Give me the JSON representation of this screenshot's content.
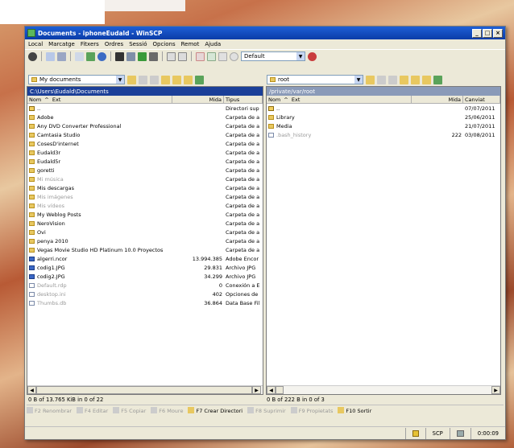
{
  "window": {
    "title": "Documents - iphoneEudald - WinSCP"
  },
  "menu": [
    "Local",
    "Marcatge",
    "Fitxers",
    "Ordres",
    "Sessió",
    "Opcions",
    "Remot",
    "Ajuda"
  ],
  "toolbar": {
    "transfer_setting": "Default"
  },
  "left_location": "My documents",
  "right_location": "root",
  "left_pane": {
    "path": "C:\\Users\\Eudald\\Documents",
    "columns": [
      "Nom",
      "Ext",
      "Mida",
      "Tipus"
    ],
    "rows": [
      {
        "name": "..",
        "size": "",
        "type": "Directori sup",
        "icon": "updir",
        "hidden": false
      },
      {
        "name": "Adobe",
        "size": "",
        "type": "Carpeta de a",
        "icon": "folder",
        "hidden": false
      },
      {
        "name": "Any DVD Converter Professional",
        "size": "",
        "type": "Carpeta de a",
        "icon": "folder",
        "hidden": false
      },
      {
        "name": "Camtasia Studio",
        "size": "",
        "type": "Carpeta de a",
        "icon": "folder",
        "hidden": false
      },
      {
        "name": "CosesD'internet",
        "size": "",
        "type": "Carpeta de a",
        "icon": "folder",
        "hidden": false
      },
      {
        "name": "Eudald3r",
        "size": "",
        "type": "Carpeta de a",
        "icon": "folder",
        "hidden": false
      },
      {
        "name": "Eudald5r",
        "size": "",
        "type": "Carpeta de a",
        "icon": "folder",
        "hidden": false
      },
      {
        "name": "goretti",
        "size": "",
        "type": "Carpeta de a",
        "icon": "folder",
        "hidden": false
      },
      {
        "name": "Mi música",
        "size": "",
        "type": "Carpeta de a",
        "icon": "folder",
        "hidden": true
      },
      {
        "name": "Mis descargas",
        "size": "",
        "type": "Carpeta de a",
        "icon": "folder",
        "hidden": false
      },
      {
        "name": "Mis imágenes",
        "size": "",
        "type": "Carpeta de a",
        "icon": "folder",
        "hidden": true
      },
      {
        "name": "Mis vídeos",
        "size": "",
        "type": "Carpeta de a",
        "icon": "folder",
        "hidden": true
      },
      {
        "name": "My Weblog Posts",
        "size": "",
        "type": "Carpeta de a",
        "icon": "folder",
        "hidden": false
      },
      {
        "name": "NeroVision",
        "size": "",
        "type": "Carpeta de a",
        "icon": "folder",
        "hidden": false
      },
      {
        "name": "Ovi",
        "size": "",
        "type": "Carpeta de a",
        "icon": "folder",
        "hidden": false
      },
      {
        "name": "penya 2010",
        "size": "",
        "type": "Carpeta de a",
        "icon": "folder",
        "hidden": false
      },
      {
        "name": "Vegas Movie Studio HD Platinum 10.0 Proyectos",
        "size": "",
        "type": "Carpeta de a",
        "icon": "folder",
        "hidden": false
      },
      {
        "name": "algerri.ncor",
        "size": "13.994.385",
        "type": "Adobe Encor",
        "icon": "file-blue",
        "hidden": false
      },
      {
        "name": "codig1.JPG",
        "size": "29.831",
        "type": "Archivo JPG",
        "icon": "file-blue",
        "hidden": false
      },
      {
        "name": "codig2.JPG",
        "size": "34.299",
        "type": "Archivo JPG",
        "icon": "file-blue",
        "hidden": false
      },
      {
        "name": "Default.rdp",
        "size": "0",
        "type": "Conexión a E",
        "icon": "file-generic",
        "hidden": true
      },
      {
        "name": "desktop.ini",
        "size": "402",
        "type": "Opciones de",
        "icon": "file-generic",
        "hidden": true
      },
      {
        "name": "Thumbs.db",
        "size": "36.864",
        "type": "Data Base Fil",
        "icon": "file-generic",
        "hidden": true
      }
    ],
    "status": "0 B of 13.765 KiB in 0 of 22"
  },
  "right_pane": {
    "path": "/private/var/root",
    "columns": [
      "Nom",
      "Ext",
      "Mida",
      "Canviat"
    ],
    "rows": [
      {
        "name": "..",
        "size": "",
        "changed": "07/07/2011",
        "icon": "updir",
        "hidden": false
      },
      {
        "name": "Library",
        "size": "",
        "changed": "25/06/2011",
        "icon": "folder",
        "hidden": false
      },
      {
        "name": "Media",
        "size": "",
        "changed": "21/07/2011",
        "icon": "folder",
        "hidden": false
      },
      {
        "name": ".bash_history",
        "size": "222",
        "changed": "03/08/2011",
        "icon": "file-generic",
        "hidden": true
      }
    ],
    "status": "0 B of 222 B in 0 of 3"
  },
  "fkeys": [
    {
      "label": "F2 Renombrar",
      "active": false
    },
    {
      "label": "F4 Editar",
      "active": false
    },
    {
      "label": "F5 Copiar",
      "active": false
    },
    {
      "label": "F6 Moure",
      "active": false
    },
    {
      "label": "F7 Crear Directori",
      "active": true
    },
    {
      "label": "F8 Suprimir",
      "active": false
    },
    {
      "label": "F9 Propietats",
      "active": false
    },
    {
      "label": "F10 Sortir",
      "active": true
    }
  ],
  "bottom": {
    "protocol": "SCP",
    "elapsed": "0:00:09"
  }
}
